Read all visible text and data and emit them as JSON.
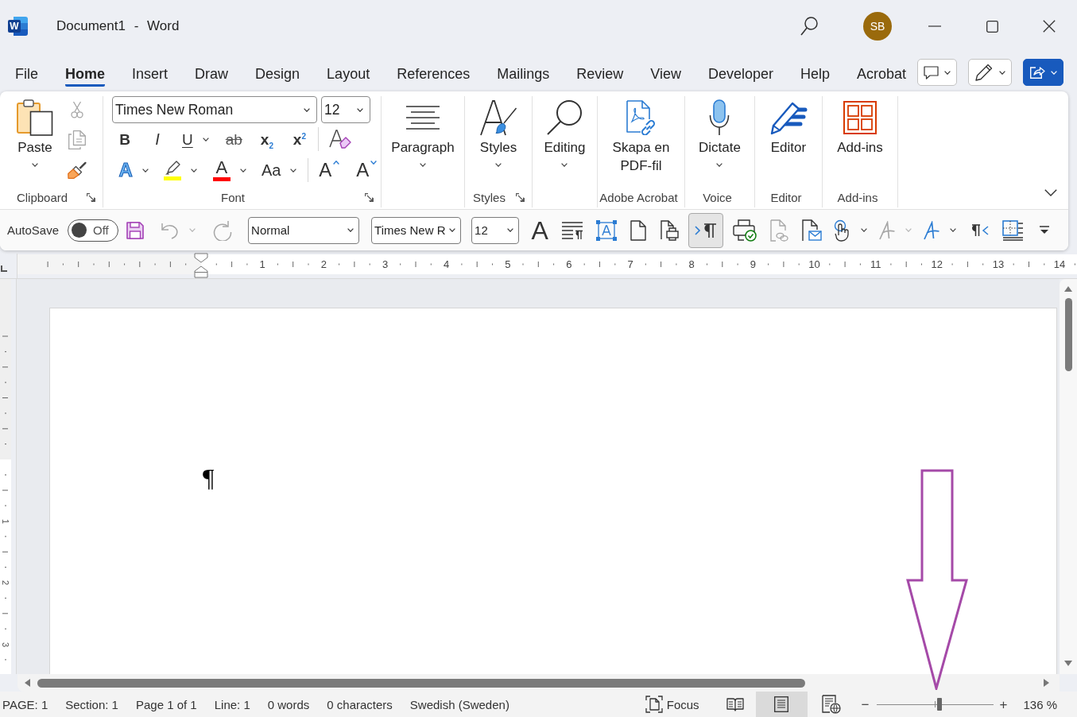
{
  "window": {
    "app_letter": "W",
    "title": "Document1 - Word",
    "user_initials": "SB"
  },
  "tabs": [
    {
      "label": "File",
      "selected": false
    },
    {
      "label": "Home",
      "selected": true
    },
    {
      "label": "Insert",
      "selected": false
    },
    {
      "label": "Draw",
      "selected": false
    },
    {
      "label": "Design",
      "selected": false
    },
    {
      "label": "Layout",
      "selected": false
    },
    {
      "label": "References",
      "selected": false
    },
    {
      "label": "Mailings",
      "selected": false
    },
    {
      "label": "Review",
      "selected": false
    },
    {
      "label": "View",
      "selected": false
    },
    {
      "label": "Developer",
      "selected": false
    },
    {
      "label": "Help",
      "selected": false
    },
    {
      "label": "Acrobat",
      "selected": false
    }
  ],
  "ribbon": {
    "groups": [
      {
        "kind": "clipboard",
        "label": "Clipboard",
        "launcher": true,
        "button_label": "Paste",
        "dropdown": true,
        "tools": [
          {
            "kind": "cut",
            "disabled": true
          },
          {
            "kind": "copy",
            "disabled": true
          },
          {
            "kind": "format_painter",
            "disabled": false
          }
        ]
      },
      {
        "kind": "font",
        "label": "Font",
        "launcher": true,
        "font_name": "Times New Roman",
        "font_size": "12",
        "row_1": [
          {
            "kind": "bold",
            "glyph": "B"
          },
          {
            "kind": "italic",
            "glyph": "I"
          },
          {
            "kind": "underline",
            "glyph": "U",
            "dropdown": true
          },
          {
            "kind": "strikethrough",
            "glyph": "ab"
          },
          {
            "kind": "subscript",
            "glyph": "x$_{2}$"
          },
          {
            "kind": "superscript",
            "glyph": "x$^{2}$"
          },
          {
            "kind": "separator"
          },
          {
            "kind": "clear_formatting"
          }
        ],
        "row_2": [
          {
            "kind": "text_effects",
            "glyph": "A",
            "dropdown": true
          },
          {
            "kind": "highlight",
            "color": "#ffff00",
            "dropdown": true
          },
          {
            "kind": "font_color",
            "glyph": "A",
            "color": "#ff0000",
            "dropdown": true
          },
          {
            "kind": "change_case",
            "glyph": "Aa",
            "dropdown": true
          },
          {
            "kind": "separator"
          },
          {
            "kind": "grow_font",
            "glyph": "A"
          },
          {
            "kind": "shrink_font",
            "glyph": "A"
          }
        ]
      },
      {
        "kind": "paragraph",
        "button_label": "Paragraph",
        "dropdown": true
      },
      {
        "kind": "styles",
        "button_label": "Styles",
        "dropdown": true,
        "label": "Styles",
        "launcher": true
      },
      {
        "kind": "editing",
        "button_label": "Editing",
        "dropdown": true
      },
      {
        "kind": "acrobat",
        "button_label": "Skapa en PDF-fil",
        "label": "Adobe Acrobat"
      },
      {
        "kind": "dictate",
        "button_label": "Dictate",
        "dropdown": true,
        "label": "Voice"
      },
      {
        "kind": "editor",
        "button_label": "Editor",
        "label": "Editor"
      },
      {
        "kind": "addins",
        "button_label": "Add-ins",
        "label": "Add-ins"
      }
    ]
  },
  "quick_access": {
    "autosave": {
      "label": "AutoSave",
      "on": false,
      "state_text": "Off"
    },
    "tools": [
      {
        "kind": "save"
      },
      {
        "kind": "undo",
        "dropdown": true,
        "disabled": true
      },
      {
        "kind": "redo",
        "disabled": true
      },
      {
        "kind": "style_select",
        "value": "Normal"
      },
      {
        "kind": "font_select",
        "value": "Times New R"
      },
      {
        "kind": "size_select",
        "value": "12"
      },
      {
        "kind": "font_glyph",
        "glyph": "A"
      },
      {
        "kind": "paragraph_marks"
      },
      {
        "kind": "text_box"
      },
      {
        "kind": "blank_page"
      },
      {
        "kind": "print_preview"
      },
      {
        "kind": "show_hide",
        "selected": true
      },
      {
        "kind": "print_check"
      },
      {
        "kind": "link_doc",
        "disabled": true
      },
      {
        "kind": "mail_doc"
      },
      {
        "kind": "touch",
        "dropdown": true
      },
      {
        "kind": "ink",
        "dropdown": true,
        "disabled": true
      },
      {
        "kind": "ink",
        "dropdown": true,
        "disabled": false
      },
      {
        "kind": "rtl"
      },
      {
        "kind": "borders"
      },
      {
        "kind": "customize"
      }
    ]
  },
  "ruler": {
    "numbers": [
      "1",
      "2",
      "3",
      "4",
      "5",
      "6",
      "7",
      "8",
      "9",
      "10",
      "11",
      "12",
      "13",
      "14"
    ]
  },
  "vertical_ruler": {
    "numbers": [
      "1",
      "2",
      "3"
    ]
  },
  "document": {
    "paragraph_mark": "¶"
  },
  "status_bar": {
    "items": [
      "PAGE: 1",
      "Section: 1",
      "Page 1 of 1",
      "Line: 1",
      "0 words",
      "0 characters",
      "Swedish (Sweden)"
    ],
    "focus_label": "Focus",
    "views": [
      {
        "kind": "read",
        "selected": false
      },
      {
        "kind": "print",
        "selected": true
      },
      {
        "kind": "web",
        "selected": false
      }
    ],
    "zoom": {
      "out_label": "−",
      "in_label": "+",
      "level": 0.54,
      "reading": "136 %"
    }
  },
  "annotations": [
    {
      "kind": "arrow"
    }
  ]
}
